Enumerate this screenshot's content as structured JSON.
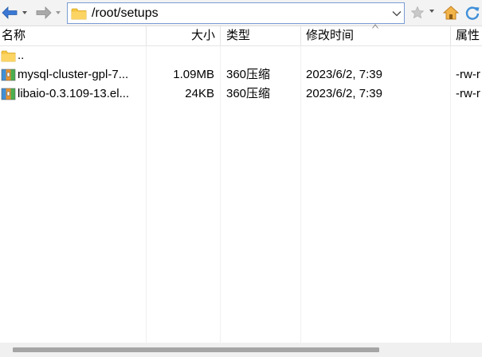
{
  "toolbar": {
    "back_icon": "back-arrow-icon",
    "forward_icon": "forward-arrow-icon",
    "path": "/root/setups",
    "bookmark_icon": "star-icon",
    "home_icon": "home-icon",
    "refresh_icon": "refresh-icon"
  },
  "columns": {
    "name": "名称",
    "size": "大小",
    "type": "类型",
    "modified": "修改时间",
    "attributes": "属性"
  },
  "files": [
    {
      "name": "..",
      "size": "",
      "type": "",
      "modified": "",
      "attributes": "",
      "icon": "folder-icon"
    },
    {
      "name": "mysql-cluster-gpl-7...",
      "size": "1.09MB",
      "type": "360压缩",
      "modified": "2023/6/2, 7:39",
      "attributes": "-rw-r",
      "icon": "archive-icon"
    },
    {
      "name": "libaio-0.3.109-13.el...",
      "size": "24KB",
      "type": "360压缩",
      "modified": "2023/6/2, 7:39",
      "attributes": "-rw-r",
      "icon": "archive-icon"
    }
  ],
  "colors": {
    "accent": "#3a78d4",
    "folder": "#f5c542",
    "home": "#e8a23a",
    "refresh": "#3f8fd8"
  }
}
